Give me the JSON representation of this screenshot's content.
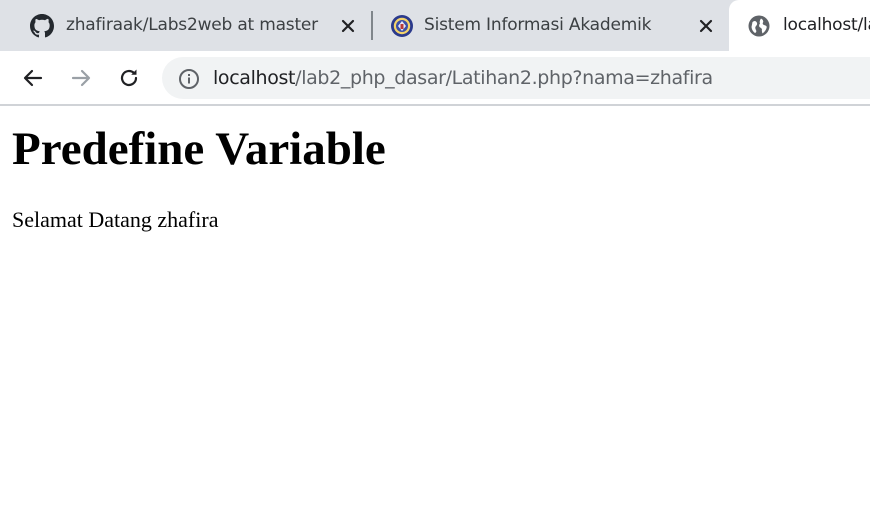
{
  "browser": {
    "tabs": [
      {
        "title": "zhafiraak/Labs2web at master",
        "icon": "github-icon",
        "active": false
      },
      {
        "title": "Sistem Informasi Akademik",
        "icon": "university-logo-icon",
        "active": false
      },
      {
        "title": "localhost/la",
        "icon": "globe-icon",
        "active": true
      }
    ],
    "address_bar": {
      "host": "localhost",
      "path": "/lab2_php_dasar/Latihan2.php?nama=zhafira",
      "icon": "info-icon"
    },
    "nav": {
      "back_icon": "arrow-left-icon",
      "forward_icon": "arrow-right-icon",
      "reload_icon": "reload-icon"
    }
  },
  "page": {
    "heading": "Predefine Variable",
    "greeting": "Selamat Datang zhafira"
  },
  "colors": {
    "tabstrip_bg": "#dee1e6",
    "omnibox_bg": "#f1f3f4",
    "text_dark": "#202124",
    "text_muted": "#5f6368"
  }
}
